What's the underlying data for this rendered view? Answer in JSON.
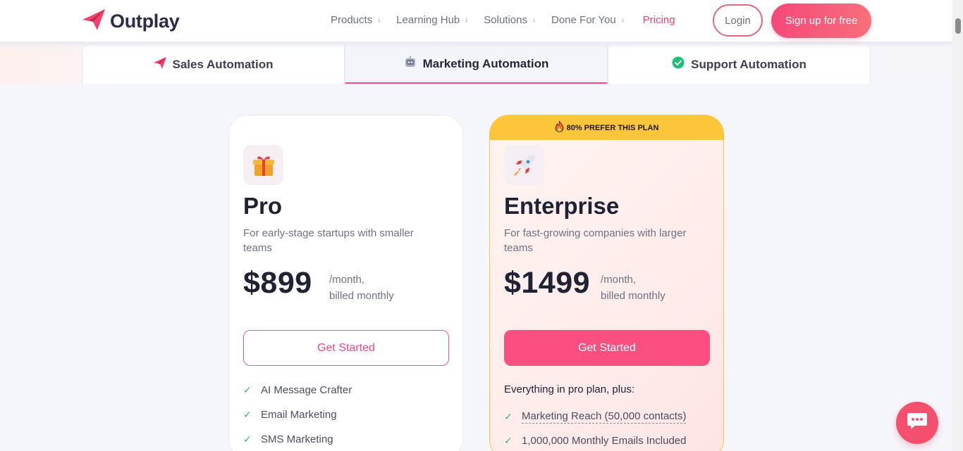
{
  "header": {
    "brand": "Outplay",
    "nav": [
      {
        "label": "Products"
      },
      {
        "label": "Learning Hub"
      },
      {
        "label": "Solutions"
      },
      {
        "label": "Done For You"
      }
    ],
    "pricing_label": "Pricing",
    "login_label": "Login",
    "signup_label": "Sign up for free",
    "accent_color": "#f0436e"
  },
  "tabs": [
    {
      "label": "Sales Automation",
      "icon": "paper-plane-icon"
    },
    {
      "label": "Marketing Automation",
      "icon": "robot-icon",
      "active": true
    },
    {
      "label": "Support Automation",
      "icon": "check-circle-icon"
    }
  ],
  "plans": {
    "pro": {
      "icon": "gift-icon",
      "name": "Pro",
      "description": "For early-stage startups with smaller teams",
      "price": "$899",
      "price_unit_1": "/month,",
      "price_unit_2": "billed monthly",
      "cta": "Get Started",
      "features": [
        "AI Message Crafter",
        "Email Marketing",
        "SMS Marketing"
      ]
    },
    "enterprise": {
      "badge": "80% PREFER THIS PLAN",
      "icon": "rocket-icon",
      "name": "Enterprise",
      "description": "For fast-growing companies with larger teams",
      "price": "$1499",
      "price_unit_1": "/month,",
      "price_unit_2": "billed monthly",
      "cta": "Get Started",
      "plus_title": "Everything in pro plan, plus:",
      "features": [
        "Marketing Reach (50,000 contacts)",
        "1,000,000 Monthly Emails Included"
      ]
    }
  },
  "chat_icon": "chat-bubble-icon"
}
